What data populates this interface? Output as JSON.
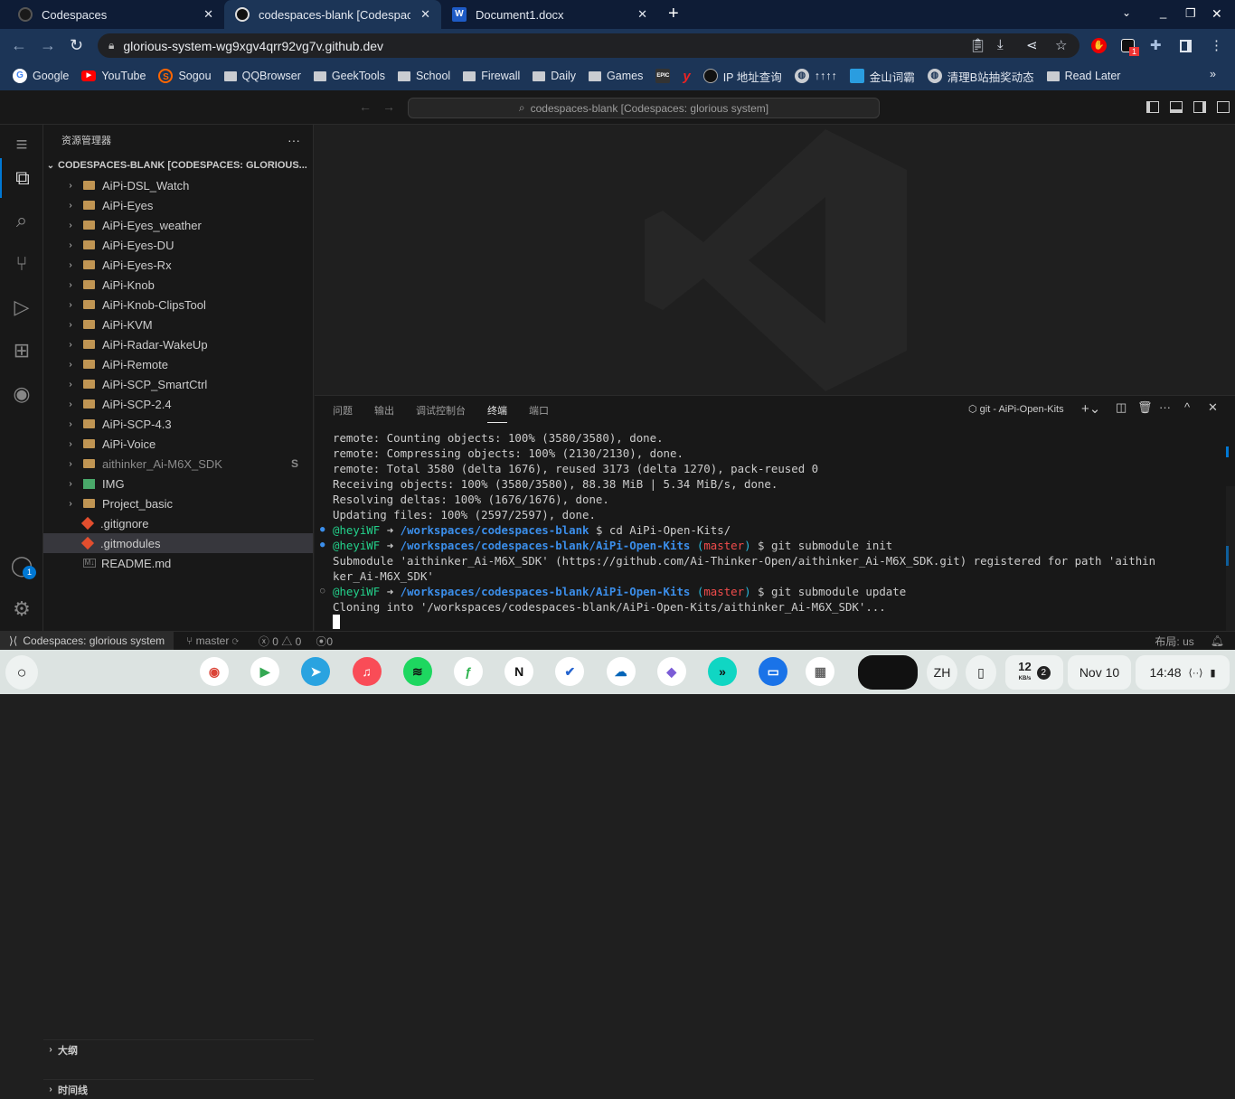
{
  "browser": {
    "tabs": [
      {
        "title": "Codespaces",
        "icon": "github-icon"
      },
      {
        "title": "codespaces-blank [Codespaces: glorious system]",
        "icon": "github-icon",
        "active": true
      },
      {
        "title": "Document1.docx",
        "icon": "word-icon"
      }
    ],
    "url": "glorious-system-wg9xgv4qrr92vg7v.github.dev",
    "extension_badge": "1",
    "bookmarks": [
      {
        "label": "Google"
      },
      {
        "label": "YouTube"
      },
      {
        "label": "Sogou"
      },
      {
        "label": "QQBrowser"
      },
      {
        "label": "GeekTools"
      },
      {
        "label": "School"
      },
      {
        "label": "Firewall"
      },
      {
        "label": "Daily"
      },
      {
        "label": "Games"
      },
      {
        "label": ""
      },
      {
        "label": ""
      },
      {
        "label": "IP 地址查询"
      },
      {
        "label": "↑↑↑↑"
      },
      {
        "label": "金山词霸"
      },
      {
        "label": "清理B站抽奖动态"
      },
      {
        "label": "Read Later"
      }
    ],
    "more_bookmarks": "»"
  },
  "vscode": {
    "command_center": "codespaces-blank [Codespaces: glorious system]",
    "account_badge": "1",
    "explorer": {
      "title": "资源管理器",
      "root": "CODESPACES-BLANK [CODESPACES: GLORIOUS...",
      "items": [
        {
          "name": "AiPi-DSL_Watch",
          "type": "folder"
        },
        {
          "name": "AiPi-Eyes",
          "type": "folder"
        },
        {
          "name": "AiPi-Eyes_weather",
          "type": "folder"
        },
        {
          "name": "AiPi-Eyes-DU",
          "type": "folder"
        },
        {
          "name": "AiPi-Eyes-Rx",
          "type": "folder"
        },
        {
          "name": "AiPi-Knob",
          "type": "folder"
        },
        {
          "name": "AiPi-Knob-ClipsTool",
          "type": "folder"
        },
        {
          "name": "AiPi-KVM",
          "type": "folder"
        },
        {
          "name": "AiPi-Radar-WakeUp",
          "type": "folder"
        },
        {
          "name": "AiPi-Remote",
          "type": "folder"
        },
        {
          "name": "AiPi-SCP_SmartCtrl",
          "type": "folder"
        },
        {
          "name": "AiPi-SCP-2.4",
          "type": "folder"
        },
        {
          "name": "AiPi-SCP-4.3",
          "type": "folder"
        },
        {
          "name": "AiPi-Voice",
          "type": "folder"
        },
        {
          "name": "aithinker_Ai-M6X_SDK",
          "type": "submodule",
          "badge": "S"
        },
        {
          "name": "IMG",
          "type": "image-folder"
        },
        {
          "name": "Project_basic",
          "type": "folder"
        },
        {
          "name": ".gitignore",
          "type": "git"
        },
        {
          "name": ".gitmodules",
          "type": "git",
          "selected": true
        },
        {
          "name": "README.md",
          "type": "markdown"
        }
      ],
      "outline": "大纲",
      "timeline": "时间线"
    },
    "panel": {
      "tabs": [
        "问题",
        "输出",
        "调试控制台",
        "终端",
        "端口"
      ],
      "active_tab": "终端",
      "terminal_name": "git - AiPi-Open-Kits",
      "lines": [
        "remote: Counting objects: 100% (3580/3580), done.",
        "remote: Compressing objects: 100% (2130/2130), done.",
        "remote: Total 3580 (delta 1676), reused 3173 (delta 1270), pack-reused 0",
        "Receiving objects: 100% (3580/3580), 88.38 MiB | 5.34 MiB/s, done.",
        "Resolving deltas: 100% (1676/1676), done.",
        "Updating files: 100% (2597/2597), done."
      ],
      "prompts": [
        {
          "user": "@heyiWF",
          "path": "/workspaces/codespaces-blank",
          "branch": "",
          "cmd": "$ cd AiPi-Open-Kits/"
        },
        {
          "user": "@heyiWF",
          "path": "/workspaces/codespaces-blank/AiPi-Open-Kits",
          "branch": "master",
          "cmd": "$ git submodule init"
        },
        {
          "user": "@heyiWF",
          "path": "/workspaces/codespaces-blank/AiPi-Open-Kits",
          "branch": "master",
          "cmd": "$ git submodule update"
        }
      ],
      "init_output_1": "Submodule 'aithinker_Ai-M6X_SDK' (https://github.com/Ai-Thinker-Open/aithinker_Ai-M6X_SDK.git) registered for path 'aithin",
      "init_output_2": "ker_Ai-M6X_SDK'",
      "update_output": "Cloning into '/workspaces/codespaces-blank/AiPi-Open-Kits/aithinker_Ai-M6X_SDK'..."
    },
    "status": {
      "remote": "Codespaces: glorious system",
      "branch": "master",
      "errors": "0",
      "warnings": "0",
      "ports": "0",
      "layout": "布局: us"
    }
  },
  "shelf": {
    "apps": [
      "Chrome",
      "Play Store",
      "Telegram",
      "Apple Music",
      "Spotify",
      "Feedly",
      "Notion",
      "Microsoft To Do",
      "OneDrive",
      "Copilot",
      "Linktree",
      "Files",
      "Chrome Apps"
    ],
    "ime": "ZH",
    "net_speed": "12",
    "net_unit": "KB/s",
    "notif_count": "2",
    "date": "Nov 10",
    "time": "14:48"
  }
}
